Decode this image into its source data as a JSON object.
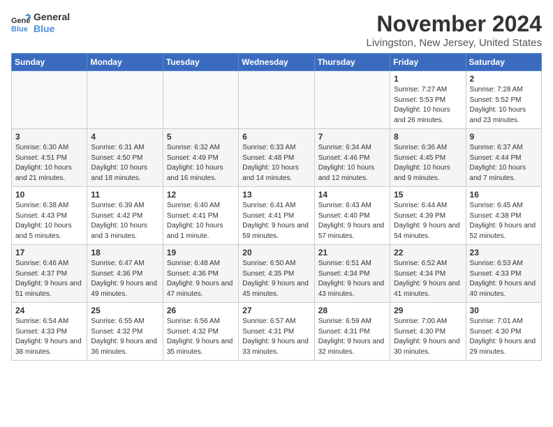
{
  "logo": {
    "line1": "General",
    "line2": "Blue"
  },
  "title": "November 2024",
  "location": "Livingston, New Jersey, United States",
  "weekdays": [
    "Sunday",
    "Monday",
    "Tuesday",
    "Wednesday",
    "Thursday",
    "Friday",
    "Saturday"
  ],
  "weeks": [
    [
      {
        "day": "",
        "info": ""
      },
      {
        "day": "",
        "info": ""
      },
      {
        "day": "",
        "info": ""
      },
      {
        "day": "",
        "info": ""
      },
      {
        "day": "",
        "info": ""
      },
      {
        "day": "1",
        "info": "Sunrise: 7:27 AM\nSunset: 5:53 PM\nDaylight: 10 hours and 26 minutes."
      },
      {
        "day": "2",
        "info": "Sunrise: 7:28 AM\nSunset: 5:52 PM\nDaylight: 10 hours and 23 minutes."
      }
    ],
    [
      {
        "day": "3",
        "info": "Sunrise: 6:30 AM\nSunset: 4:51 PM\nDaylight: 10 hours and 21 minutes."
      },
      {
        "day": "4",
        "info": "Sunrise: 6:31 AM\nSunset: 4:50 PM\nDaylight: 10 hours and 18 minutes."
      },
      {
        "day": "5",
        "info": "Sunrise: 6:32 AM\nSunset: 4:49 PM\nDaylight: 10 hours and 16 minutes."
      },
      {
        "day": "6",
        "info": "Sunrise: 6:33 AM\nSunset: 4:48 PM\nDaylight: 10 hours and 14 minutes."
      },
      {
        "day": "7",
        "info": "Sunrise: 6:34 AM\nSunset: 4:46 PM\nDaylight: 10 hours and 12 minutes."
      },
      {
        "day": "8",
        "info": "Sunrise: 6:36 AM\nSunset: 4:45 PM\nDaylight: 10 hours and 9 minutes."
      },
      {
        "day": "9",
        "info": "Sunrise: 6:37 AM\nSunset: 4:44 PM\nDaylight: 10 hours and 7 minutes."
      }
    ],
    [
      {
        "day": "10",
        "info": "Sunrise: 6:38 AM\nSunset: 4:43 PM\nDaylight: 10 hours and 5 minutes."
      },
      {
        "day": "11",
        "info": "Sunrise: 6:39 AM\nSunset: 4:42 PM\nDaylight: 10 hours and 3 minutes."
      },
      {
        "day": "12",
        "info": "Sunrise: 6:40 AM\nSunset: 4:41 PM\nDaylight: 10 hours and 1 minute."
      },
      {
        "day": "13",
        "info": "Sunrise: 6:41 AM\nSunset: 4:41 PM\nDaylight: 9 hours and 59 minutes."
      },
      {
        "day": "14",
        "info": "Sunrise: 6:43 AM\nSunset: 4:40 PM\nDaylight: 9 hours and 57 minutes."
      },
      {
        "day": "15",
        "info": "Sunrise: 6:44 AM\nSunset: 4:39 PM\nDaylight: 9 hours and 54 minutes."
      },
      {
        "day": "16",
        "info": "Sunrise: 6:45 AM\nSunset: 4:38 PM\nDaylight: 9 hours and 52 minutes."
      }
    ],
    [
      {
        "day": "17",
        "info": "Sunrise: 6:46 AM\nSunset: 4:37 PM\nDaylight: 9 hours and 51 minutes."
      },
      {
        "day": "18",
        "info": "Sunrise: 6:47 AM\nSunset: 4:36 PM\nDaylight: 9 hours and 49 minutes."
      },
      {
        "day": "19",
        "info": "Sunrise: 6:48 AM\nSunset: 4:36 PM\nDaylight: 9 hours and 47 minutes."
      },
      {
        "day": "20",
        "info": "Sunrise: 6:50 AM\nSunset: 4:35 PM\nDaylight: 9 hours and 45 minutes."
      },
      {
        "day": "21",
        "info": "Sunrise: 6:51 AM\nSunset: 4:34 PM\nDaylight: 9 hours and 43 minutes."
      },
      {
        "day": "22",
        "info": "Sunrise: 6:52 AM\nSunset: 4:34 PM\nDaylight: 9 hours and 41 minutes."
      },
      {
        "day": "23",
        "info": "Sunrise: 6:53 AM\nSunset: 4:33 PM\nDaylight: 9 hours and 40 minutes."
      }
    ],
    [
      {
        "day": "24",
        "info": "Sunrise: 6:54 AM\nSunset: 4:33 PM\nDaylight: 9 hours and 38 minutes."
      },
      {
        "day": "25",
        "info": "Sunrise: 6:55 AM\nSunset: 4:32 PM\nDaylight: 9 hours and 36 minutes."
      },
      {
        "day": "26",
        "info": "Sunrise: 6:56 AM\nSunset: 4:32 PM\nDaylight: 9 hours and 35 minutes."
      },
      {
        "day": "27",
        "info": "Sunrise: 6:57 AM\nSunset: 4:31 PM\nDaylight: 9 hours and 33 minutes."
      },
      {
        "day": "28",
        "info": "Sunrise: 6:59 AM\nSunset: 4:31 PM\nDaylight: 9 hours and 32 minutes."
      },
      {
        "day": "29",
        "info": "Sunrise: 7:00 AM\nSunset: 4:30 PM\nDaylight: 9 hours and 30 minutes."
      },
      {
        "day": "30",
        "info": "Sunrise: 7:01 AM\nSunset: 4:30 PM\nDaylight: 9 hours and 29 minutes."
      }
    ]
  ]
}
